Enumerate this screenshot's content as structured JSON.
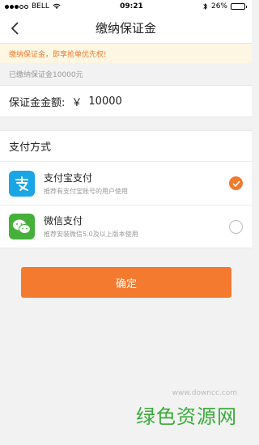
{
  "status_bar": {
    "carrier": "BELL",
    "time": "09:21",
    "battery": "26%",
    "battery_level": 0.26
  },
  "nav": {
    "title": "缴纳保证金",
    "back_icon": "chevron-left-icon"
  },
  "notice": "缴纳保证金，即享抢单优先权!",
  "paid_info": "已缴纳保证金10000元",
  "amount": {
    "label": "保证金金额:",
    "currency": "￥",
    "value": "10000"
  },
  "payment": {
    "header": "支付方式",
    "options": [
      {
        "name": "支付宝支付",
        "desc": "推荐有支付宝账号的用户使用",
        "icon": "alipay-icon",
        "selected": true
      },
      {
        "name": "微信支付",
        "desc": "推荐安装微信5.0及以上版本使用",
        "icon": "wechat-icon",
        "selected": false
      }
    ]
  },
  "confirm_label": "确定",
  "watermark": {
    "title": "绿色资源网",
    "url": "www.downcc.com"
  },
  "colors": {
    "accent": "#f47a30",
    "alipay": "#1aa6e5",
    "wechat": "#45b13a",
    "watermark": "#3aaa3a"
  }
}
